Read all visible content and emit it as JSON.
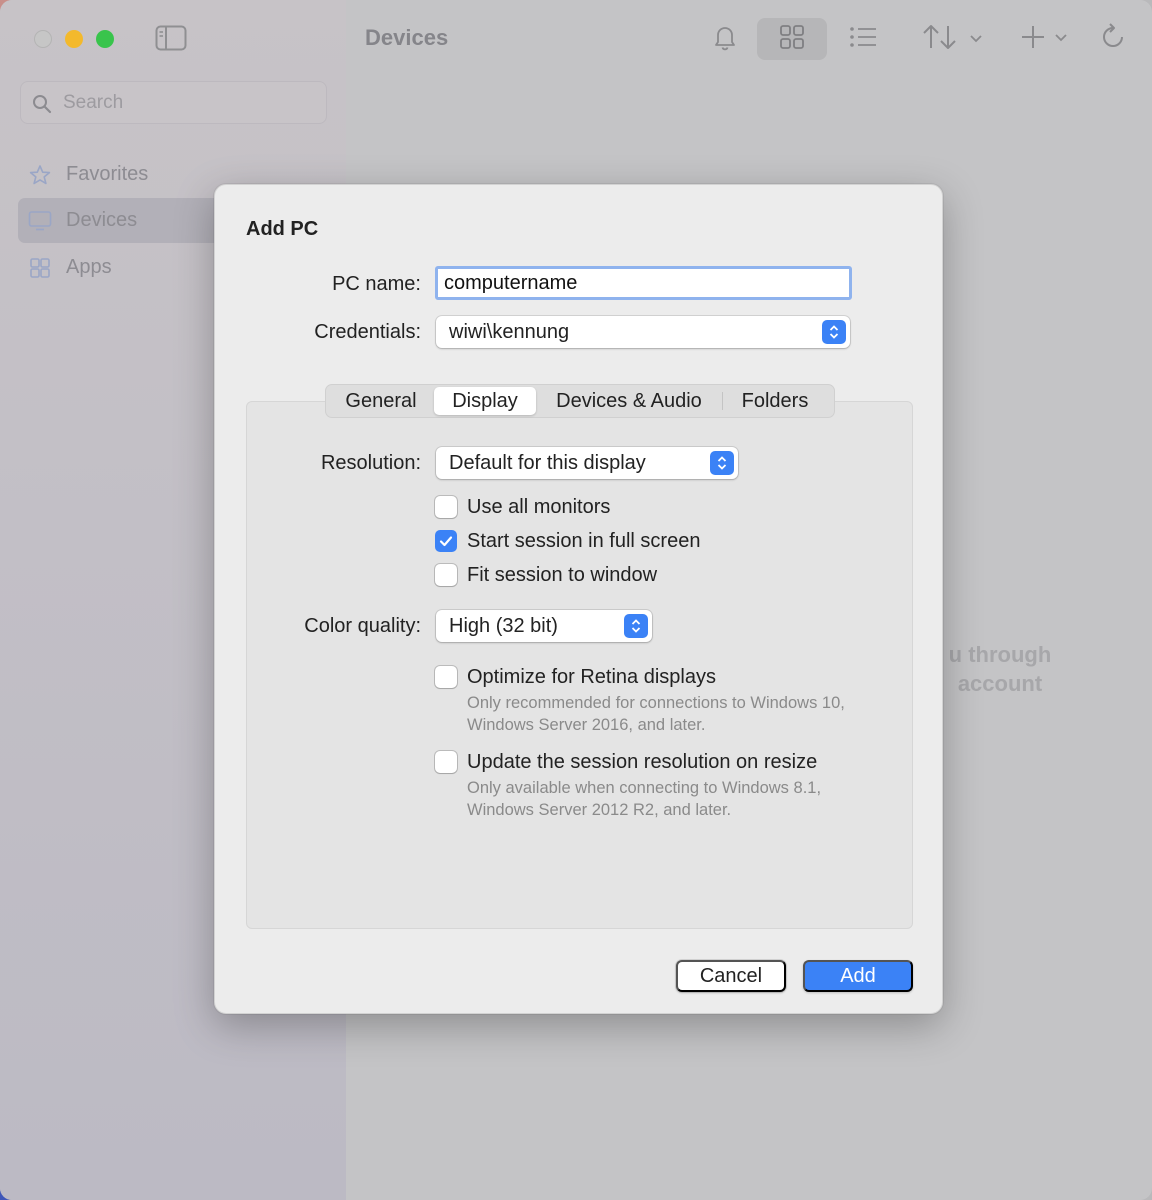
{
  "window": {
    "title": "Devices"
  },
  "sidebar": {
    "search_placeholder": "Search",
    "items": [
      {
        "label": "Favorites",
        "icon": "star-icon"
      },
      {
        "label": "Devices",
        "icon": "monitor-icon",
        "active": true
      },
      {
        "label": "Apps",
        "icon": "apps-icon"
      }
    ]
  },
  "toolbar": {
    "icons": [
      "bell-icon",
      "grid-view-icon",
      "list-view-icon",
      "sort-icon",
      "add-icon",
      "refresh-icon"
    ]
  },
  "empty_state": {
    "line1": "u through",
    "line2": "account"
  },
  "dialog": {
    "title": "Add PC",
    "pc_name_label": "PC name:",
    "pc_name_value": "computername",
    "credentials_label": "Credentials:",
    "credentials_value": "wiwi\\kennung",
    "tabs": [
      "General",
      "Display",
      "Devices & Audio",
      "Folders"
    ],
    "selected_tab": "Display",
    "resolution_label": "Resolution:",
    "resolution_value": "Default for this display",
    "monitor_options": [
      {
        "label": "Use all monitors",
        "checked": false
      },
      {
        "label": "Start session in full screen",
        "checked": true
      },
      {
        "label": "Fit session to window",
        "checked": false
      }
    ],
    "color_quality_label": "Color quality:",
    "color_quality_value": "High (32 bit)",
    "retina_option": {
      "label": "Optimize for Retina displays",
      "help": "Only recommended for connections to Windows 10, Windows Server 2016, and later.",
      "checked": false
    },
    "resize_option": {
      "label": "Update the session resolution on resize",
      "help": "Only available when connecting to Windows 8.1, Windows Server 2012 R2, and later.",
      "checked": false
    },
    "cancel_label": "Cancel",
    "add_label": "Add"
  },
  "colors": {
    "accent": "#3b82f6",
    "dialog_bg": "#ececec"
  }
}
